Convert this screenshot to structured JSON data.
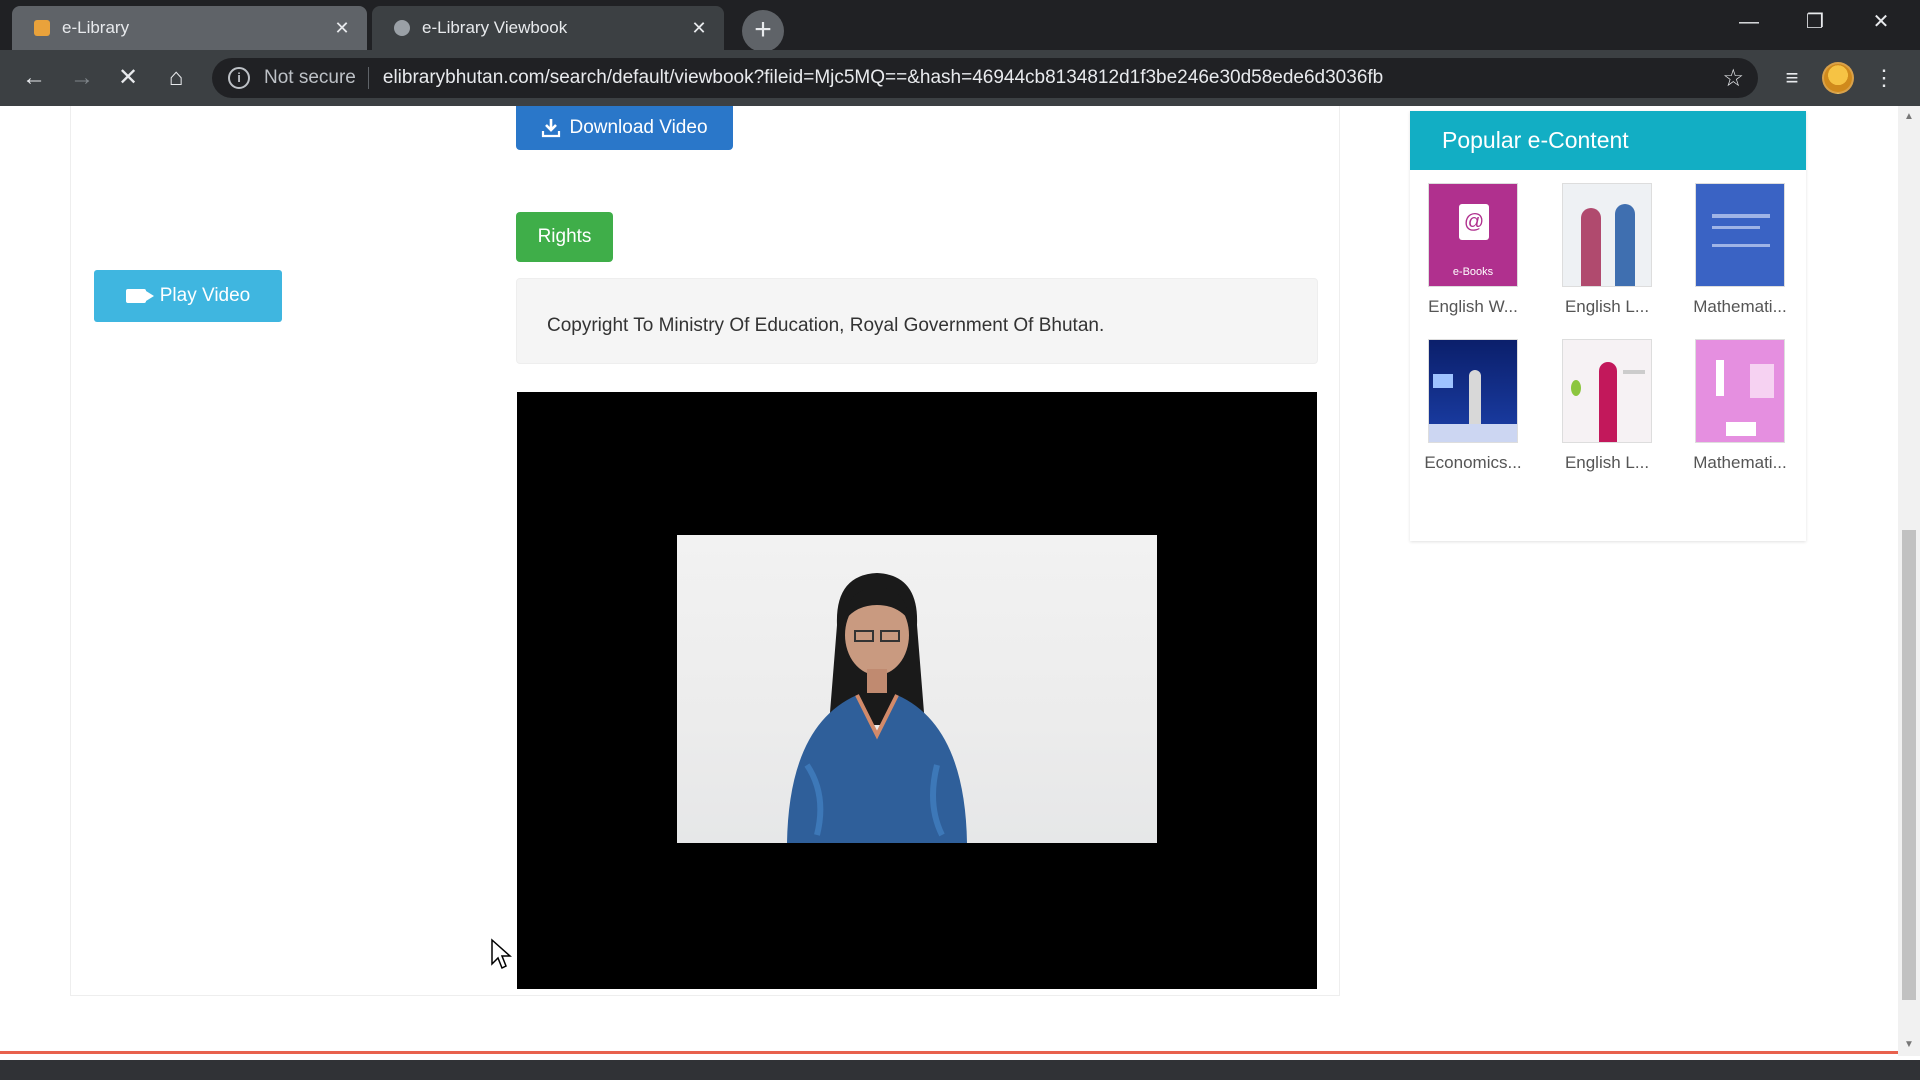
{
  "browser": {
    "tabs": [
      {
        "title": "e-Library",
        "active": false
      },
      {
        "title": "e-Library Viewbook",
        "active": true
      }
    ],
    "address": {
      "security_label": "Not secure",
      "url": "elibrarybhutan.com/search/default/viewbook?fileid=Mjc5MQ==&hash=46944cb8134812d1f3be246e30d58ede6d3036fb"
    },
    "colors": {
      "chrome_dark": "#202124",
      "toolbar": "#3c4043"
    }
  },
  "page": {
    "download_button_label": "Download Video",
    "rights_button_label": "Rights",
    "play_button_label": "Play Video",
    "copyright_text": "Copyright To Ministry Of Education, Royal Government Of Bhutan.",
    "colors": {
      "download": "#2a77c9",
      "rights": "#3fae49",
      "play": "#3fb6e0",
      "sidebar_header": "#12aec4"
    }
  },
  "sidebar": {
    "title": "Popular e-Content",
    "items": [
      {
        "label": "English W...",
        "thumb": "ebook-purple"
      },
      {
        "label": "English L...",
        "thumb": "two-presenters"
      },
      {
        "label": "Mathemati...",
        "thumb": "blue-cover"
      },
      {
        "label": "Economics...",
        "thumb": "dark-stage"
      },
      {
        "label": "English L...",
        "thumb": "presenter-pink"
      },
      {
        "label": "Mathemati...",
        "thumb": "pink-number"
      }
    ]
  }
}
